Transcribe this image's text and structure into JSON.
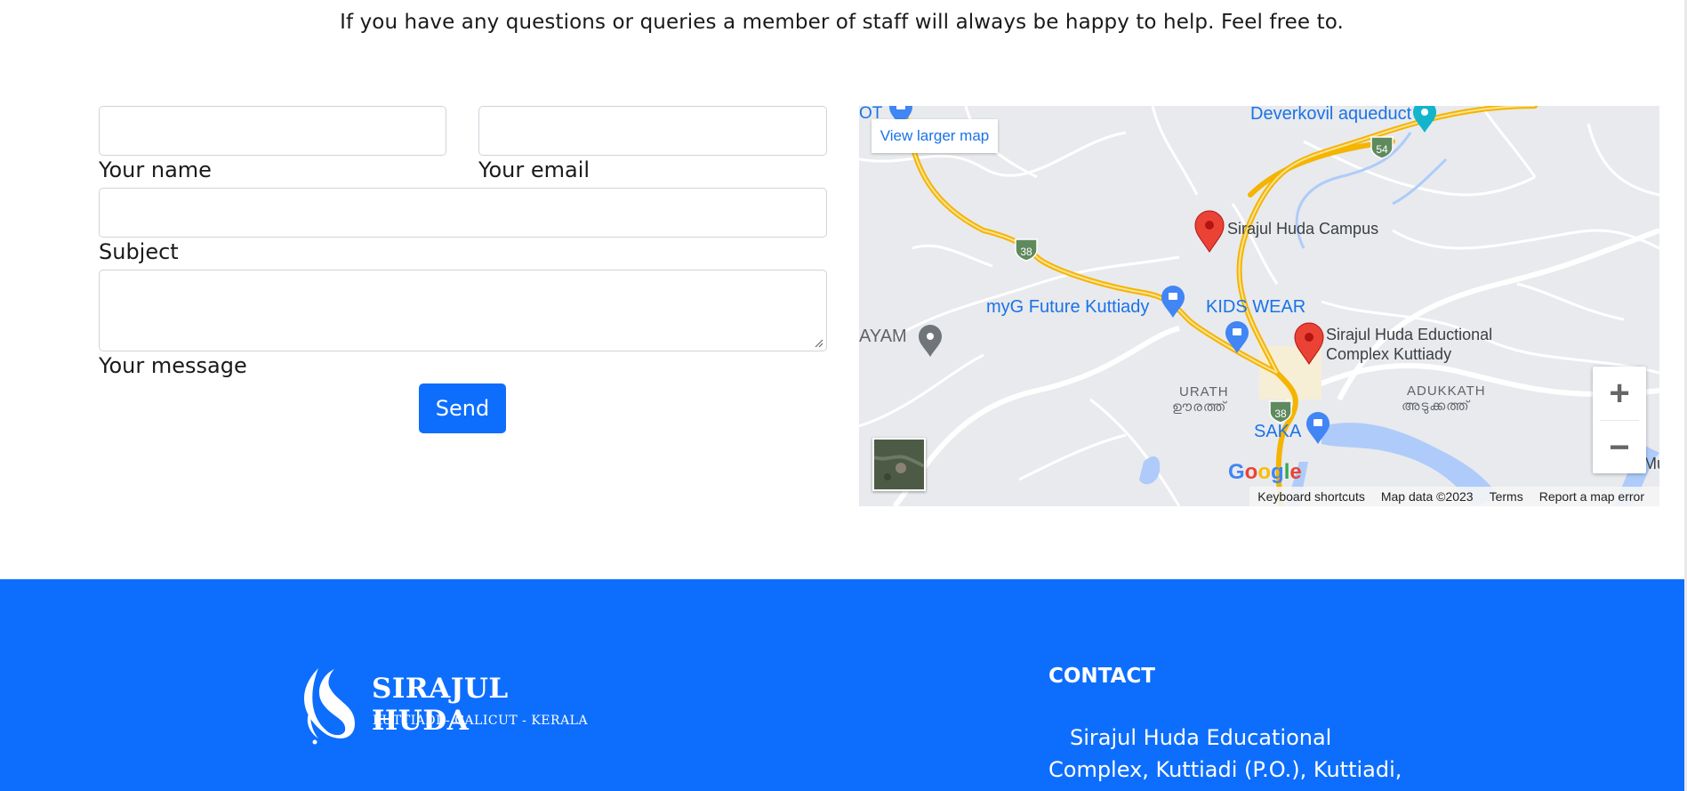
{
  "intro_text": "If you have any questions or queries a member of staff will always be happy to help. Feel free to.",
  "form": {
    "name_label": "Your name",
    "email_label": "Your email",
    "subject_label": "Subject",
    "message_label": "Your message",
    "name_value": "",
    "email_value": "",
    "subject_value": "",
    "message_value": "",
    "send_label": "Send"
  },
  "map": {
    "view_larger": "View larger map",
    "places": {
      "deverkovil": "Deverkovil aqueduct",
      "campus": "Sirajul Huda Campus",
      "myg": "myG Future Kuttiady",
      "kids_wear": "KIDS WEAR",
      "complex_line1": "Sirajul Huda Eductional",
      "complex_line2": "Complex Kuttiady",
      "ayam": "AYAM",
      "urath": "URATH",
      "urath_ml": "ഊരത്ത്",
      "adukkath": "ADUKKATH",
      "adukkath_ml": "അടുക്കത്ത്",
      "saka": "SAKA",
      "ot": "OT",
      "mu": "Mu"
    },
    "road_numbers": {
      "r38a": "38",
      "r38b": "38",
      "r54": "54"
    },
    "google": "Google",
    "attribution": [
      "Keyboard shortcuts",
      "Map data ©2023",
      "Terms",
      "Report a map error"
    ],
    "zoom_in": "+",
    "zoom_out": "−"
  },
  "footer": {
    "logo_title": "SIRAJUL HUDA",
    "logo_subtitle": "KUTTIADI - CALICUT - KERALA",
    "contact_title": "CONTACT",
    "contact_address": "Sirajul Huda Educational Complex, Kuttiadi (P.O.), Kuttiadi,"
  },
  "colors": {
    "primary": "#0d6efd",
    "map_bg": "#e8eaed",
    "road_yellow": "#fbc02d",
    "pin_red": "#ea4335",
    "pin_blue": "#4285f4",
    "water": "#aecbfa"
  }
}
